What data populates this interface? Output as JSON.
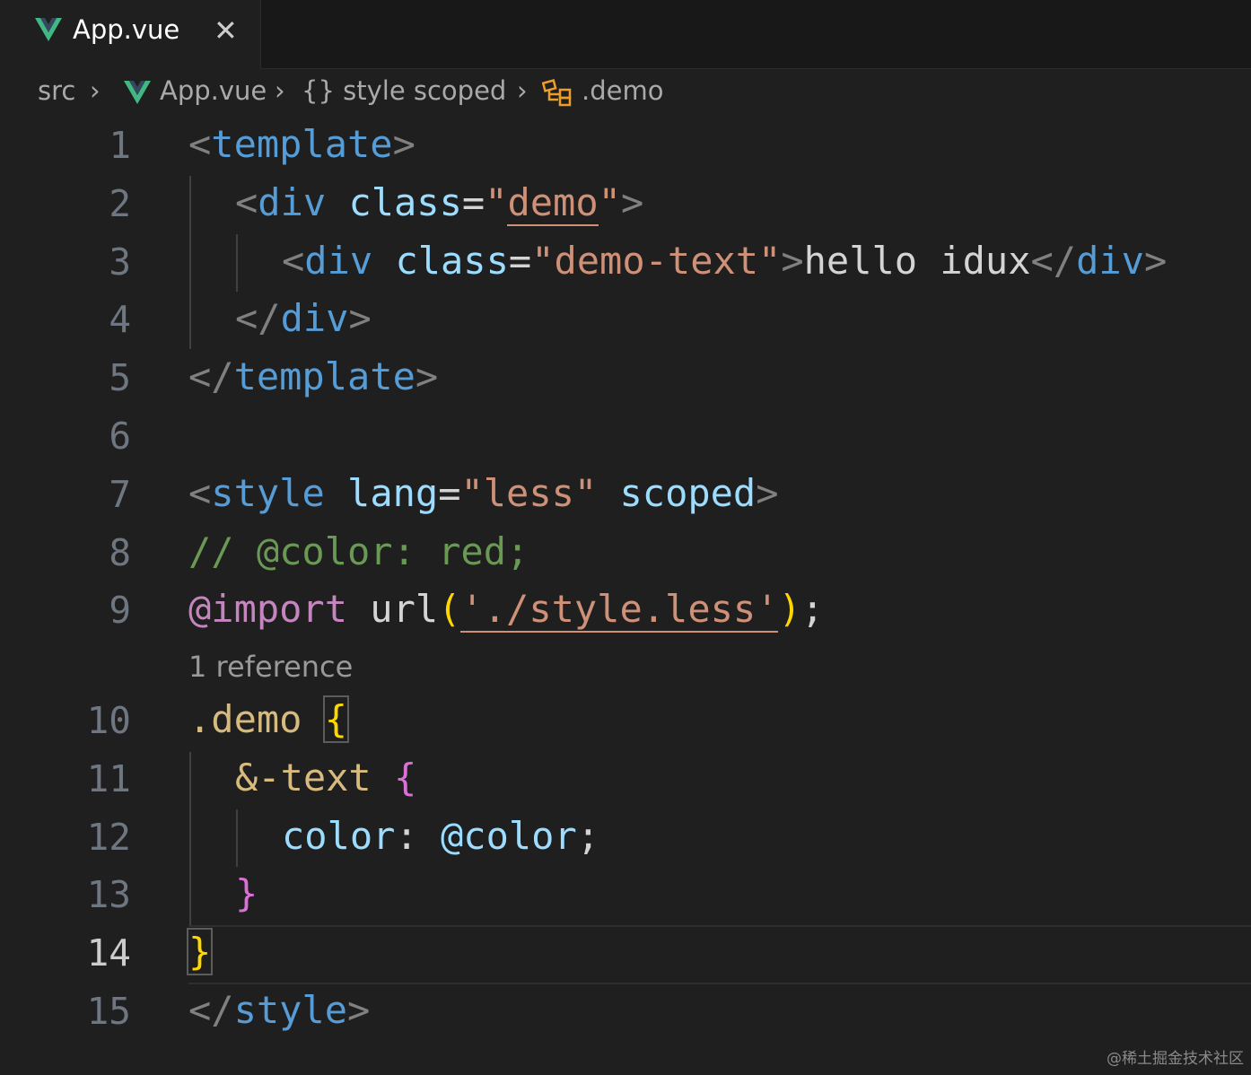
{
  "tab": {
    "title": "App.vue",
    "close": "✕"
  },
  "breadcrumb": {
    "items": [
      "src",
      "App.vue",
      "{} style scoped",
      ".demo"
    ],
    "sep": "›"
  },
  "line_numbers": [
    "1",
    "2",
    "3",
    "4",
    "5",
    "6",
    "7",
    "8",
    "9",
    "10",
    "11",
    "12",
    "13",
    "14",
    "15"
  ],
  "active_line": "14",
  "codelens": "1 reference",
  "code": {
    "l1": [
      "<",
      "template",
      ">"
    ],
    "l2": [
      "<",
      "div",
      " ",
      "class",
      "=",
      "\"",
      "demo",
      "\"",
      ">"
    ],
    "l3": [
      "<",
      "div",
      " ",
      "class",
      "=",
      "\"demo-text\"",
      ">",
      "hello idux",
      "</",
      "div",
      ">"
    ],
    "l4": [
      "</",
      "div",
      ">"
    ],
    "l5": [
      "</",
      "template",
      ">"
    ],
    "l7": [
      "<",
      "style",
      " ",
      "lang",
      "=",
      "\"less\"",
      " ",
      "scoped",
      ">"
    ],
    "l8": "// @color: red;",
    "l9": [
      "@import",
      " url",
      "(",
      "'./style.less'",
      ")",
      ";"
    ],
    "l10": [
      ".demo",
      " ",
      "{"
    ],
    "l11": [
      "&-text",
      " ",
      "{"
    ],
    "l12": [
      "color",
      ": ",
      "@color",
      ";"
    ],
    "l13": "}",
    "l14": "}",
    "l15": [
      "</",
      "style",
      ">"
    ]
  },
  "watermark": "@稀土掘金技术社区"
}
